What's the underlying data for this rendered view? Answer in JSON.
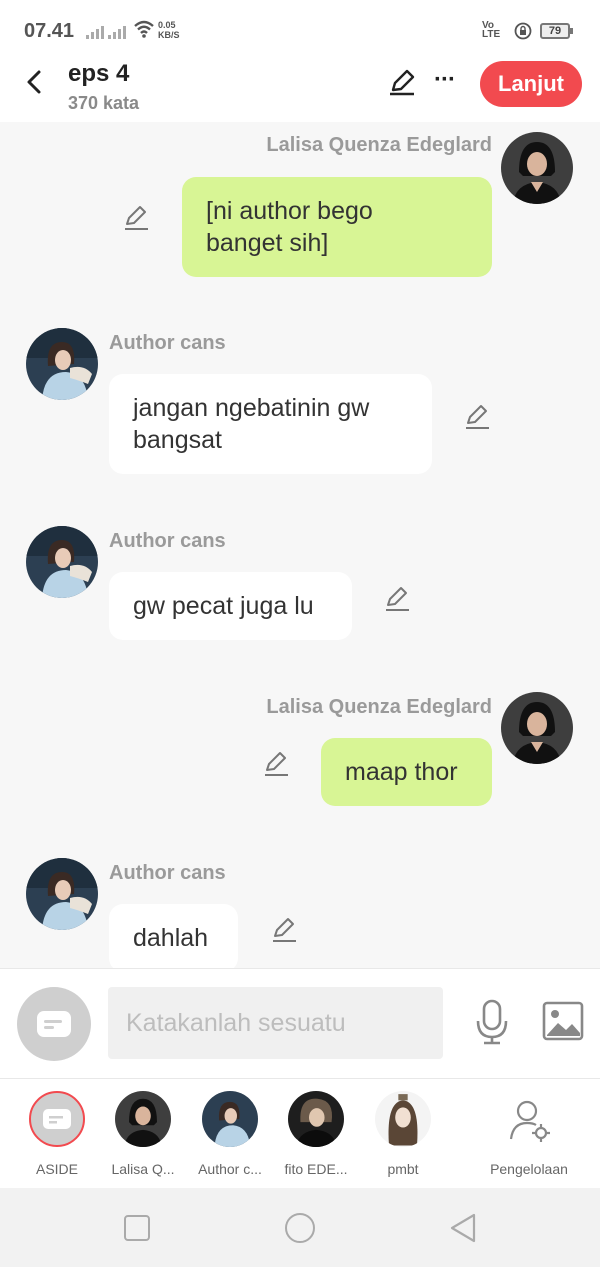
{
  "status_bar": {
    "time": "07.41",
    "net_speed_value": "0.05",
    "net_speed_unit": "KB/S",
    "volte_top": "Vo",
    "volte_bottom": "LTE",
    "battery": "79"
  },
  "header": {
    "title": "eps 4",
    "subtitle": "370 kata",
    "continue_label": "Lanjut"
  },
  "messages": [
    {
      "sender": "Lalisa Quenza Edeglard",
      "text_lines": [
        "[ni author bego",
        "banget sih]"
      ],
      "side": "right"
    },
    {
      "sender": "Author cans",
      "text_lines": [
        "jangan ngebatinin gw",
        "bangsat"
      ],
      "side": "left"
    },
    {
      "sender": "Author cans",
      "text_lines": [
        "gw pecat juga lu"
      ],
      "side": "left"
    },
    {
      "sender": "Lalisa Quenza Edeglard",
      "text_lines": [
        "maap thor"
      ],
      "side": "right"
    },
    {
      "sender": "Author cans",
      "text_lines": [
        "dahlah"
      ],
      "side": "left"
    }
  ],
  "composer": {
    "placeholder": "Katakanlah sesuatu"
  },
  "characters": [
    {
      "label": "ASIDE",
      "icon": "aside-icon"
    },
    {
      "label": "Lalisa Q...",
      "icon": "avatar-lalisa"
    },
    {
      "label": "Author c...",
      "icon": "avatar-author"
    },
    {
      "label": "fito EDE...",
      "icon": "avatar-fito"
    },
    {
      "label": "pmbt",
      "icon": "avatar-pmbt"
    },
    {
      "label": "Pengelolaan",
      "icon": "user-settings-icon"
    }
  ],
  "colors": {
    "accent": "#f24a4f",
    "my_bubble": "#d8f595",
    "their_bubble": "#ffffff"
  }
}
